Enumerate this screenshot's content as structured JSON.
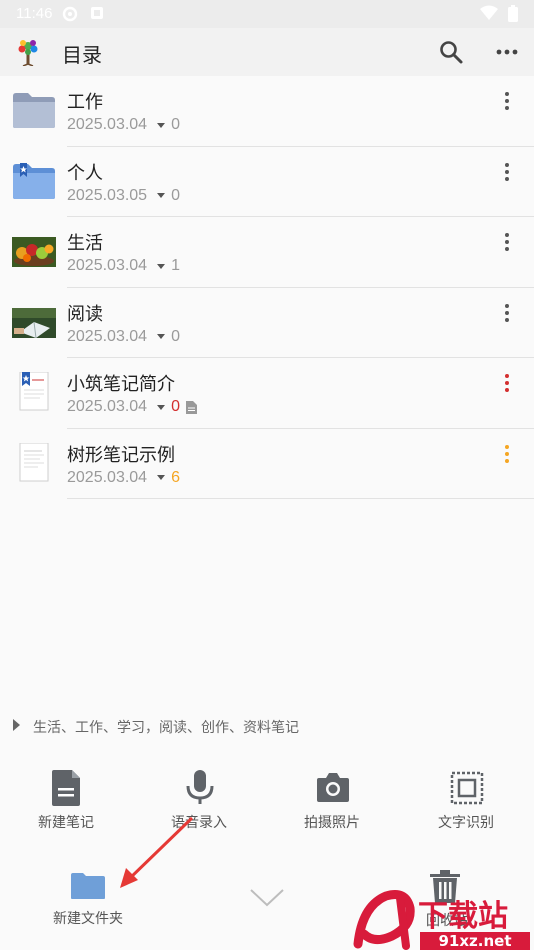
{
  "status_bar": {
    "time": "11:46"
  },
  "app_bar": {
    "title": "目录",
    "icons": [
      "tree-logo-icon",
      "search-icon",
      "more-vert-icon"
    ]
  },
  "items": [
    {
      "name": "工作",
      "date": "2025.03.04",
      "count": "0",
      "icon": "folder-icon"
    },
    {
      "name": "个人",
      "date": "2025.03.05",
      "count": "0",
      "icon": "bookmark-folder-icon"
    },
    {
      "name": "生活",
      "date": "2025.03.04",
      "count": "1",
      "icon": "fruit-photo-icon"
    },
    {
      "name": "阅读",
      "date": "2025.03.04",
      "count": "0",
      "icon": "reading-photo-icon"
    },
    {
      "name": "小筑笔记简介",
      "date": "2025.03.04",
      "count": "0",
      "icon": "bookmark-note-icon",
      "count_color": "#d32f2f"
    },
    {
      "name": "树形笔记示例",
      "date": "2025.03.04",
      "count": "6",
      "icon": "note-page-icon",
      "count_color": "#f5a623"
    }
  ],
  "hint": "生活、工作、学习，阅读、创作、资料笔记",
  "toolbar": {
    "new_note": "新建笔记",
    "voice_input": "语音录入",
    "take_photo": "拍摄照片",
    "ocr": "文字识别",
    "new_folder": "新建文件夹",
    "recycle_bin": "回收站"
  },
  "watermark": {
    "main": "下载站",
    "url": "91xz.net"
  },
  "colors": {
    "accent": "#6f9fd8",
    "annotation_arrow": "#e53935",
    "watermark": "#d81b3b"
  }
}
